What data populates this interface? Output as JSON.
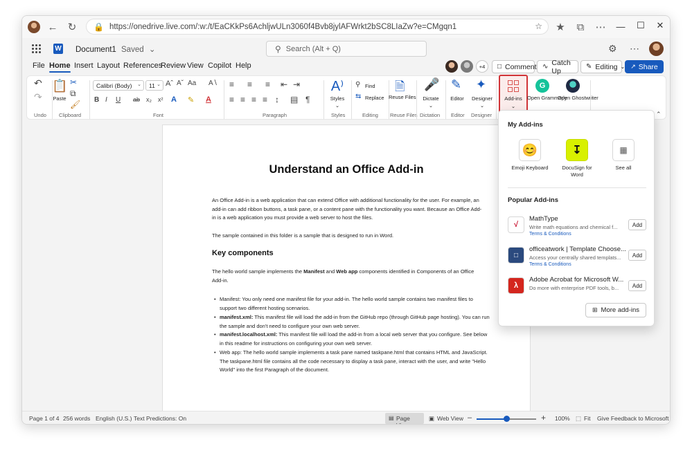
{
  "browser": {
    "url": "https://onedrive.live.com/:w:/t/EaCKkPs6AchljwULn3060f4Bvb8jylAFWrkt2bSC8LIaZw?e=CMgqn1"
  },
  "word": {
    "doc_title": "Document1",
    "saved_status": "Saved",
    "search_placeholder": "Search (Alt + Q)",
    "coauthor_count": "+4",
    "comments_label": "Comments",
    "catchup_label": "Catch Up",
    "editing_label": "Editing",
    "share_label": "Share"
  },
  "tabs": [
    "File",
    "Home",
    "Insert",
    "Layout",
    "References",
    "Review",
    "View",
    "Copilot",
    "Help"
  ],
  "ribbon": {
    "groups": {
      "undo": "Undo",
      "clipboard": "Clipboard",
      "font": "Font",
      "paragraph": "Paragraph",
      "styles": "Styles",
      "editing": "Editing",
      "reuse_files": "Reuse Files",
      "dictation": "Dictation",
      "designer": "Designer"
    },
    "paste_label": "Paste",
    "font_name": "Calibri (Body)",
    "font_size": "11",
    "styles_label": "Styles",
    "find_label": "Find",
    "replace_label": "Replace",
    "reuse_files_label": "Reuse Files",
    "dictate_label": "Dictate",
    "editor_label": "Editor",
    "designer_label": "Designer",
    "addins_label": "Add-ins",
    "grammarly_label": "Open Grammarly",
    "ghostwriter_label": "Open Ghostwriter"
  },
  "document": {
    "title": "Understand an Office Add-in",
    "para1": "An Office Add-in is a web application that can extend Office with additional functionality for the user. For example, an add-in can add ribbon buttons, a task pane, or a content pane with the functionality you want. Because an Office Add-in is a web application you must provide a web server to host the files.",
    "para2": "The sample contained in this folder is a sample that is designed to run in Word.",
    "heading2": "Key components",
    "para3_pre": "The hello world sample implements the ",
    "para3_b1": "Manifest",
    "para3_mid": " and ",
    "para3_b2": "Web app",
    "para3_post": " components identified in Components of an Office Add-in.",
    "bullet1": "Manifest: You only need one manifest file for your add-in. The hello world sample contains two manifest files to support two different hosting scenarios.",
    "bullet2_b": "manifest.xml:",
    "bullet2": " This manifest file will load the add-in from the GitHub repo (through GitHub page hosting). You can run the sample and don't need to configure your own web server.",
    "bullet3_b": "manifest.localhost.xml:",
    "bullet3": " This manifest file will load the add-in from a local web server that you configure. See below in this readme for instructions on configuring your own web server.",
    "bullet4": "Web app: The hello world sample implements a task pane named taskpane.html that contains HTML and JavaScript. The taskpane.html file contains all the code necessary to display a task pane, interact with the user, and write \"Hello World\" into the first Paragraph of the document."
  },
  "statusbar": {
    "page": "Page 1 of 4",
    "words": "256 words",
    "language": "English (U.S.)",
    "predictions": "Text Predictions: On",
    "page_view": "Page View",
    "web_view": "Web View",
    "zoom": "100%",
    "zoom_level": 0.5,
    "fit": "Fit",
    "feedback": "Give Feedback to Microsoft"
  },
  "addins_panel": {
    "my_heading": "My Add-ins",
    "my_items": [
      {
        "label": "Emoji Keyboard"
      },
      {
        "label": "DocuSign for Word"
      },
      {
        "label": "See all"
      }
    ],
    "popular_heading": "Popular Add-ins",
    "popular": [
      {
        "name": "MathType",
        "desc": "Write math equations and chemical f...",
        "terms": "Terms & Conditions",
        "add": "Add"
      },
      {
        "name": "officeatwork | Template Choose...",
        "desc": "Access your centrally shared templats...",
        "terms": "Terms & Conditions",
        "add": "Add"
      },
      {
        "name": "Adobe Acrobat for Microsoft W...",
        "desc": "Do more with enterprise PDF tools, b...",
        "terms": "",
        "add": "Add"
      }
    ],
    "more_label": "More add-ins"
  },
  "colors": {
    "accent": "#185abd",
    "addins_highlight": "#d13438",
    "grammarly": "#15c39a",
    "adobe": "#d4261e"
  }
}
